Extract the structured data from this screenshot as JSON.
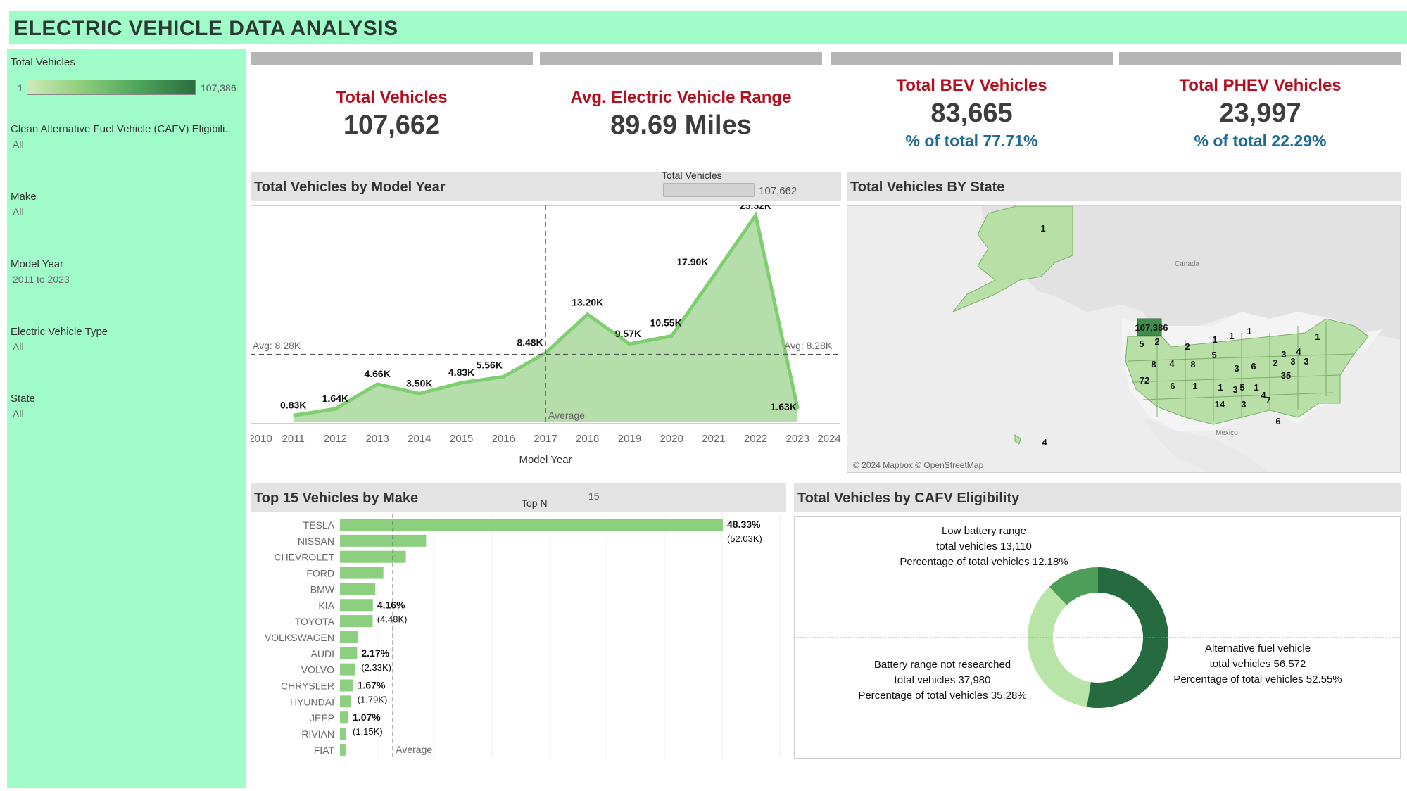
{
  "title": "ELECTRIC VEHICLE DATA ANALYSIS",
  "filters": {
    "total_vehicles": {
      "label": "Total Vehicles",
      "min": "1",
      "max": "107,386"
    },
    "cafv": {
      "label": "Clean Alternative Fuel Vehicle (CAFV) Eligibili..",
      "value": "All"
    },
    "make": {
      "label": "Make",
      "value": "All"
    },
    "model_year": {
      "label": "Model Year",
      "value": "2011 to 2023"
    },
    "ev_type": {
      "label": "Electric Vehicle Type",
      "value": "All"
    },
    "state": {
      "label": "State",
      "value": "All"
    }
  },
  "kpis": {
    "total_vehicles": {
      "title": "Total Vehicles",
      "value": "107,662"
    },
    "avg_range": {
      "title": "Avg. Electric Vehicle Range",
      "value": "89.69 Miles"
    },
    "bev": {
      "title": "Total BEV Vehicles",
      "value": "83,665",
      "pct": "% of total 77.71%"
    },
    "phev": {
      "title": "Total PHEV Vehicles",
      "value": "23,997",
      "pct": "% of total 22.29%"
    }
  },
  "colors": {
    "kpi_title": "#b30f1f",
    "kpi_pct": "#1f6a95",
    "accent_bg": "#a0fcc8",
    "area_fill": "#a8d89c",
    "area_line": "#7fcf72",
    "bar": "#8ccf7e",
    "donut_dark": "#266b3f",
    "donut_mid": "#4e9e5a",
    "donut_light": "#b8e4a8"
  },
  "year_chart": {
    "title": "Total Vehicles by Model Year",
    "slider_label": "Total Vehicles",
    "slider_value": "107,662",
    "avg_left": "Avg: 8.28K",
    "avg_right": "Avg: 8.28K",
    "avg_tag": "Average",
    "x_title": "Model Year"
  },
  "map": {
    "title": "Total Vehicles BY State",
    "label_canada": "Canada",
    "label_mexico": "Mexico",
    "attribution": "© 2024 Mapbox © OpenStreetMap",
    "labels": [
      "1",
      "107,386",
      "5",
      "2",
      "2",
      "1",
      "1",
      "1",
      "5",
      "8",
      "4",
      "8",
      "3",
      "6",
      "2",
      "3",
      "4",
      "3",
      "35",
      "3",
      "72",
      "6",
      "1",
      "1",
      "3",
      "5",
      "1",
      "4",
      "7",
      "14",
      "3",
      "6",
      "1",
      "4"
    ]
  },
  "make_chart": {
    "title": "Top 15 Vehicles by Make",
    "topn_label": "Top N",
    "topn_value": "15",
    "avg_tag": "Average",
    "bar_labels": [
      {
        "pct": "48.33%",
        "val": "(52.03K)"
      },
      {
        "pct": "4.16%",
        "val": "(4.48K)"
      },
      {
        "pct": "2.17%",
        "val": "(2.33K)"
      },
      {
        "pct": "1.67%",
        "val": "(1.79K)"
      },
      {
        "pct": "1.07%",
        "val": "(1.15K)"
      }
    ]
  },
  "cafv_chart": {
    "title": "Total Vehicles by CAFV Eligibility",
    "low": [
      "Low battery range",
      "total vehicles 13,110",
      "Percentage of total vehicles 12.18%"
    ],
    "not_researched": [
      "Battery range not researched",
      "total vehicles 37,980",
      "Percentage of total vehicles 35.28%"
    ],
    "eligible": [
      "Alternative fuel vehicle",
      "total vehicles 56,572",
      "Percentage of total vehicles 52.55%"
    ]
  },
  "chart_data": [
    {
      "type": "area",
      "title": "Total Vehicles by Model Year",
      "xlabel": "Model Year",
      "ylabel": "",
      "x": [
        2011,
        2012,
        2013,
        2014,
        2015,
        2016,
        2017,
        2018,
        2019,
        2020,
        2021,
        2022,
        2023
      ],
      "values": [
        0.83,
        1.64,
        4.66,
        3.5,
        4.83,
        5.56,
        8.48,
        13.2,
        9.57,
        10.55,
        17.9,
        25.32,
        1.63
      ],
      "data_labels": [
        "0.83K",
        "1.64K",
        "4.66K",
        "3.50K",
        "4.83K",
        "5.56K",
        "8.48K",
        "13.20K",
        "9.57K",
        "10.55K",
        "17.90K",
        "25.32K",
        "1.63K"
      ],
      "x_ticks": [
        "2010",
        "2011",
        "2012",
        "2013",
        "2014",
        "2015",
        "2016",
        "2017",
        "2018",
        "2019",
        "2020",
        "2021",
        "2022",
        "2023",
        "2024"
      ],
      "xlim": [
        2010,
        2024
      ],
      "ylim": [
        0,
        25.32
      ],
      "reference_lines": {
        "average_y": 8.28,
        "average_x": 2017
      },
      "grid": false
    },
    {
      "type": "bar",
      "orientation": "horizontal",
      "title": "Top 15 Vehicles by Make",
      "categories": [
        "TESLA",
        "NISSAN",
        "CHEVROLET",
        "FORD",
        "BMW",
        "KIA",
        "TOYOTA",
        "VOLKSWAGEN",
        "AUDI",
        "VOLVO",
        "CHRYSLER",
        "HYUNDAI",
        "JEEP",
        "RIVIAN",
        "FIAT"
      ],
      "values": [
        52.03,
        11.7,
        8.95,
        5.9,
        4.8,
        4.48,
        4.45,
        2.5,
        2.33,
        2.1,
        1.79,
        1.45,
        1.15,
        0.85,
        0.75
      ],
      "reference_lines": {
        "average_x": 7.2
      },
      "grid": true
    },
    {
      "type": "pie",
      "title": "Total Vehicles by CAFV Eligibility",
      "categories": [
        "Alternative fuel vehicle",
        "Battery range not researched",
        "Low battery range"
      ],
      "values": [
        56572,
        37980,
        13110
      ],
      "percentages": [
        52.55,
        35.28,
        12.18
      ],
      "donut": true
    }
  ]
}
